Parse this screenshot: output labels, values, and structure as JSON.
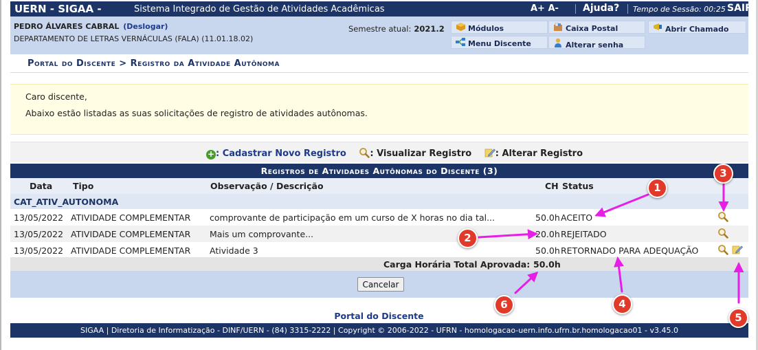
{
  "header": {
    "brand": "UERN - SIGAA -",
    "system_name": "Sistema Integrado de Gestão de Atividades Acadêmicas",
    "font_controls": "A+ A-",
    "help": "Ajuda?",
    "session_label": "Tempo de Sessão: 00:25",
    "logout": "SAIR"
  },
  "user": {
    "name": "PEDRO ÁLVARES CABRAL",
    "logout_link": "(Deslogar)",
    "department": "DEPARTAMENTO DE LETRAS VERNÁCULAS (FALA) (11.01.18.02)",
    "semester_label": "Semestre atual:",
    "semester_value": "2021.2"
  },
  "user_menu": {
    "modules": "Módulos",
    "mailbox": "Caixa Postal",
    "open_ticket": "Abrir Chamado",
    "student_menu": "Menu Discente",
    "change_password": "Alterar senha"
  },
  "breadcrumb": "Portal do Discente > Registro da Atividade Autônoma",
  "notice": {
    "greeting": "Caro discente,",
    "text": "Abaixo estão listadas as suas solicitações de registro de atividades autônomas."
  },
  "legend": {
    "new_record": ": Cadastrar Novo Registro",
    "view_record": ": Visualizar Registro",
    "edit_record": ": Alterar Registro"
  },
  "table": {
    "caption": "Registros de Atividades Autônomas do Discente (3)",
    "columns": [
      "Data",
      "Tipo",
      "Observação / Descrição",
      "CH",
      "Status"
    ],
    "group": "CAT_ATIV_AUTONOMA",
    "rows": [
      {
        "date": "13/05/2022",
        "type": "ATIVIDADE COMPLEMENTAR",
        "description": "comprovante de participação em um curso de X horas no dia tal...",
        "ch": "50.0h",
        "status": "ACEITO"
      },
      {
        "date": "13/05/2022",
        "type": "ATIVIDADE COMPLEMENTAR",
        "description": "Mais um comprovante...",
        "ch": "20.0h",
        "status": "REJEITADO"
      },
      {
        "date": "13/05/2022",
        "type": "ATIVIDADE COMPLEMENTAR",
        "description": "Atividade 3",
        "ch": "50.0h",
        "status": "RETORNADO PARA ADEQUAÇÃO"
      }
    ],
    "total_label": "Carga Horária Total Aprovada:",
    "total_value": "50.0h",
    "cancel": "Cancelar"
  },
  "footer": {
    "portal_link": "Portal do Discente",
    "text": "SIGAA | Diretoria de Informatização - DINF/UERN - (84) 3315-2222 | Copyright © 2006-2022 - UFRN - homologacao-uern.info.ufrn.br.homologacao01 - v3.45.0"
  },
  "annotations": [
    "1",
    "2",
    "3",
    "4",
    "5",
    "6"
  ],
  "colors": {
    "header_bg": "#1d3566",
    "panel_bg": "#c8d7ee",
    "notice_bg": "#fffde3",
    "marker": "#e23a2a",
    "arrow": "#e61ee6"
  },
  "icons": {
    "new": "plus-circle-icon",
    "view": "magnifier-icon",
    "edit": "edit-note-icon"
  }
}
